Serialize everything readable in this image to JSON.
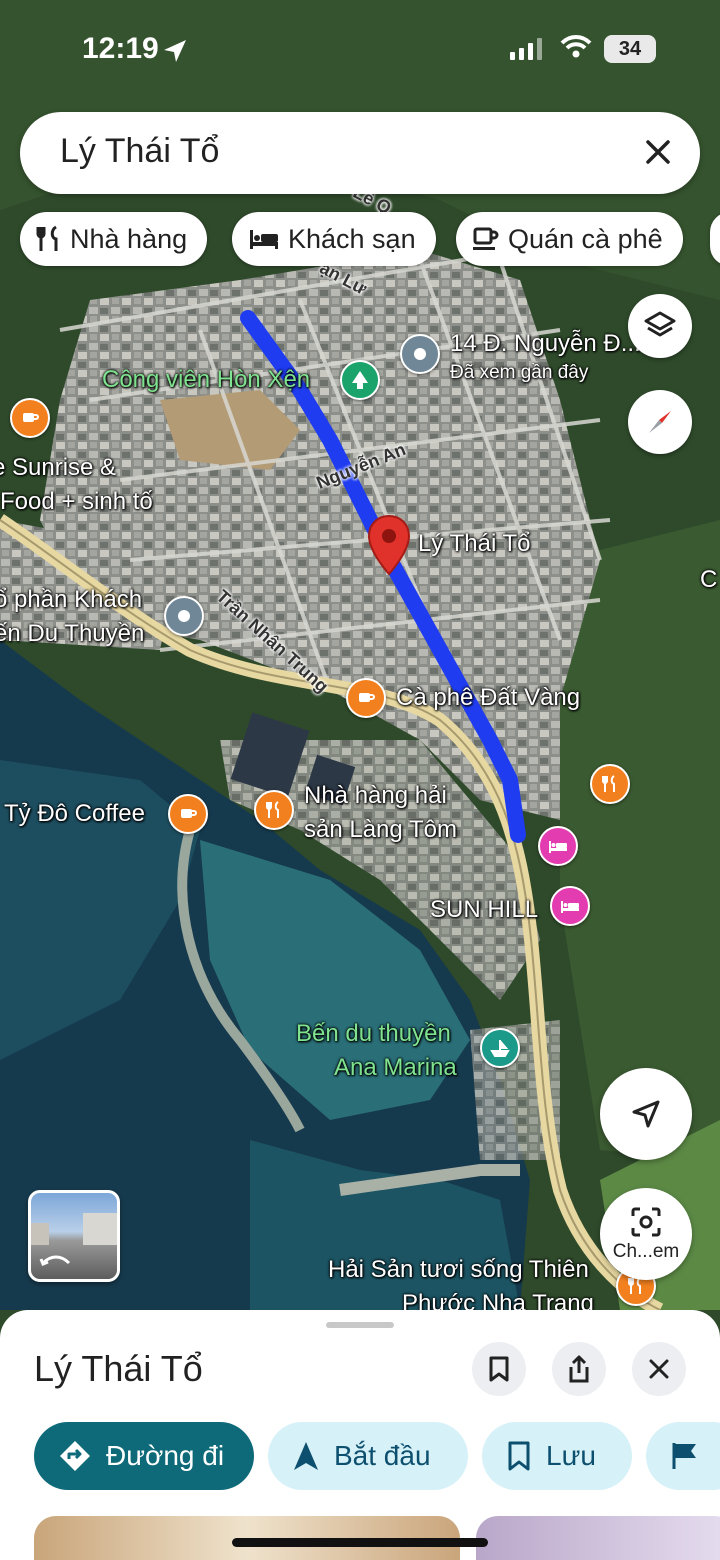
{
  "status_bar": {
    "time": "12:19",
    "battery": "34"
  },
  "search": {
    "query": "Lý Thái Tổ"
  },
  "chips": [
    {
      "label": "Nhà hàng",
      "icon": "restaurant-icon"
    },
    {
      "label": "Khách sạn",
      "icon": "hotel-icon"
    },
    {
      "label": "Quán cà phê",
      "icon": "coffee-icon"
    }
  ],
  "map": {
    "places": {
      "park": "Công viên Hòn Xện",
      "recent_address": "14 Đ. Nguyễn Đ...",
      "recent_note": "Đã xem gần đây",
      "sunrise_1": "e Sunrise &",
      "sunrise_2": "Food + sinh tố",
      "pin_label": "Lý Thái Tổ",
      "khach_1": "ổ phần Khách",
      "khach_2": "ến Du Thuyền",
      "cafe_dat_vang": "Cà phê Đất Vàng",
      "ty_do": "Tỷ Đô Coffee",
      "lang_tom_1": "Nhà hàng hải",
      "lang_tom_2": "sản Làng Tôm",
      "sun_hill": "SUN HILL",
      "marina_1": "Bến du thuyền",
      "marina_2": "Ana Marina",
      "hai_san_1": "Hải Sản tươi sống Thiên",
      "hai_san_2": "Phước Nha Trang",
      "edge_c": "C"
    },
    "streets": {
      "nguyen_an": "Nguyễn An",
      "tran_nhan_tong": "Trần Nhân Trung",
      "an_lu": "ạn Lư",
      "le": "Lê Q"
    }
  },
  "lens": {
    "label": "Ch...em"
  },
  "sheet": {
    "title": "Lý Thái Tổ",
    "actions": [
      {
        "label": "Đường đi"
      },
      {
        "label": "Bắt đầu"
      },
      {
        "label": "Lưu"
      }
    ]
  },
  "colors": {
    "route": "#1f3cf0",
    "primary_action": "#0e6a78",
    "secondary_action": "#d6f1f7",
    "pin": "#e0322b"
  }
}
